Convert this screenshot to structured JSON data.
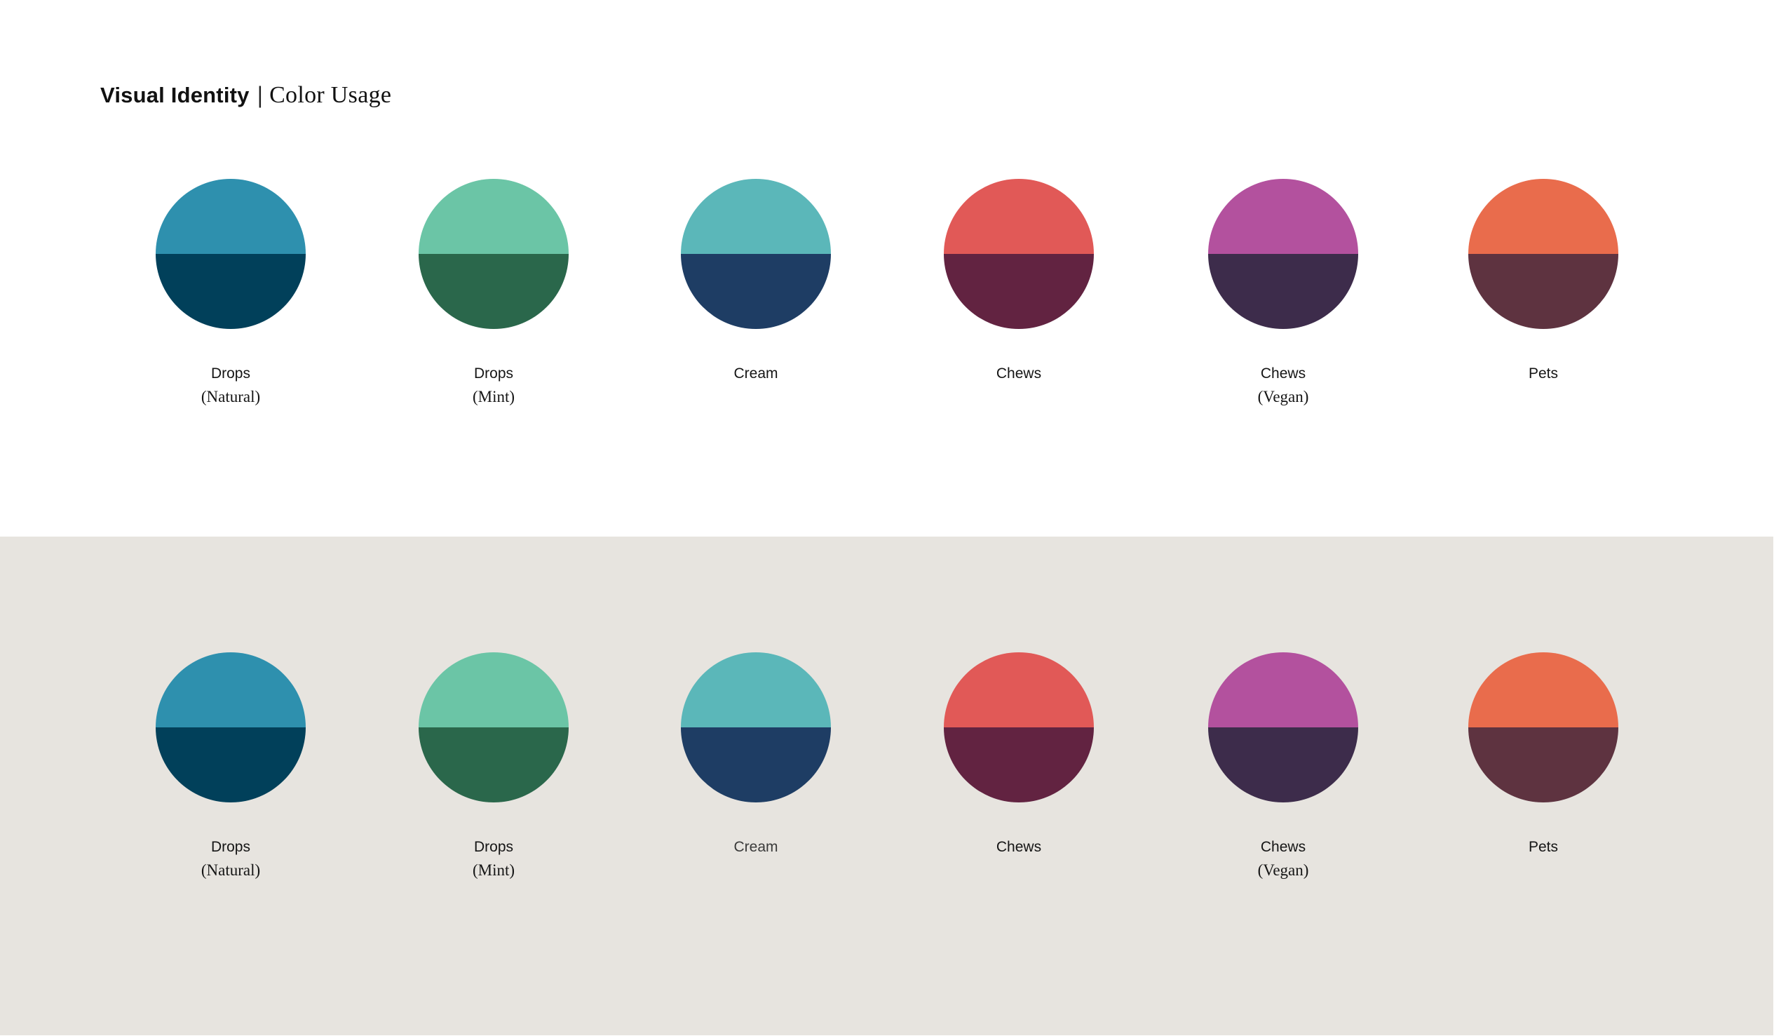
{
  "title": {
    "primary": "Visual Identity",
    "separator": "|",
    "secondary": "Color Usage"
  },
  "background_colors": {
    "top_section": "#ffffff",
    "bottom_section": "#e7e4df"
  },
  "rows": [
    {
      "background": "white",
      "swatches": [
        {
          "name": "Drops",
          "variant": "(Natural)",
          "top_color": "#2e90ae",
          "bottom_color": "#01405a"
        },
        {
          "name": "Drops",
          "variant": "(Mint)",
          "top_color": "#6bc5a6",
          "bottom_color": "#2a674b"
        },
        {
          "name": "Cream",
          "variant": "",
          "top_color": "#5bb7b9",
          "bottom_color": "#1e3d64"
        },
        {
          "name": "Chews",
          "variant": "",
          "top_color": "#e15957",
          "bottom_color": "#622341"
        },
        {
          "name": "Chews",
          "variant": "(Vegan)",
          "top_color": "#b3519e",
          "bottom_color": "#3d2c4b"
        },
        {
          "name": "Pets",
          "variant": "",
          "top_color": "#e96c4c",
          "bottom_color": "#5e3340"
        }
      ]
    },
    {
      "background": "warm-gray",
      "swatches": [
        {
          "name": "Drops",
          "variant": "(Natural)",
          "top_color": "#2e90ae",
          "bottom_color": "#01405a"
        },
        {
          "name": "Drops",
          "variant": "(Mint)",
          "top_color": "#6bc5a6",
          "bottom_color": "#2a674b"
        },
        {
          "name": "Cream",
          "variant": "",
          "top_color": "#5bb7b9",
          "bottom_color": "#1e3d64"
        },
        {
          "name": "Chews",
          "variant": "",
          "top_color": "#e15957",
          "bottom_color": "#622341"
        },
        {
          "name": "Chews",
          "variant": "(Vegan)",
          "top_color": "#b3519e",
          "bottom_color": "#3d2c4b"
        },
        {
          "name": "Pets",
          "variant": "",
          "top_color": "#e96c4c",
          "bottom_color": "#5e3340"
        }
      ]
    }
  ]
}
